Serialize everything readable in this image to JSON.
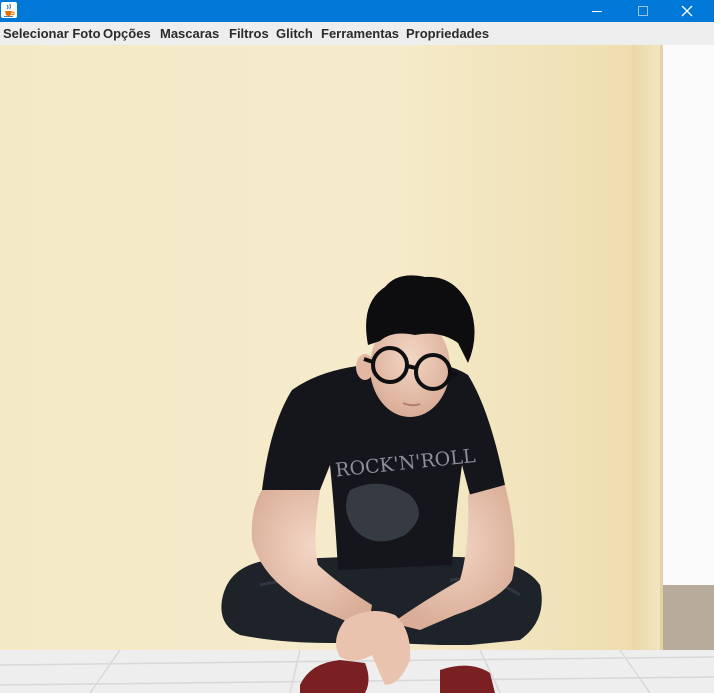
{
  "window": {
    "app_icon": "java-cup-icon",
    "controls": [
      "minimize-icon",
      "maximize-icon",
      "close-icon"
    ],
    "titlebar_color": "#0078d7"
  },
  "menu": {
    "items": [
      "Selecionar Foto",
      "Opções",
      "Mascaras",
      "Filtros",
      "Glitch",
      "Ferramentas",
      "Propriedades"
    ]
  },
  "canvas": {
    "print_text": "ROCK'N'ROLL",
    "wall_color": "#f2e6c3",
    "shirt_color": "#15161c"
  }
}
